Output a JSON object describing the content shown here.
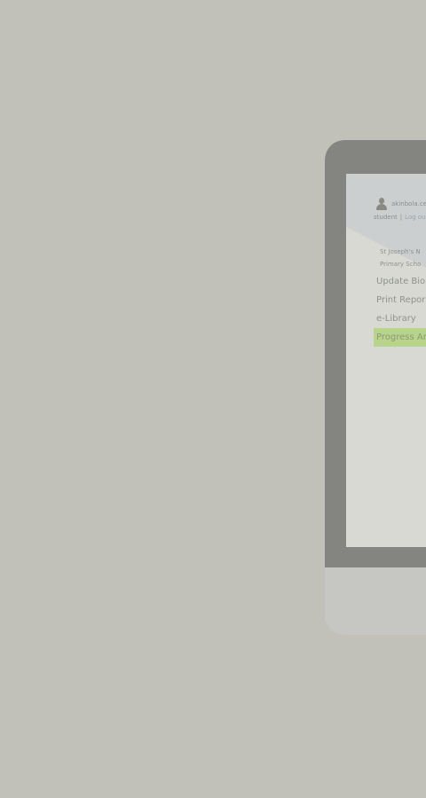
{
  "user": {
    "avatar_icon": "user-silhouette-icon",
    "username": "akinbola.ce",
    "role": "student",
    "separator": "|",
    "logout_label": "Log out"
  },
  "school": {
    "line1": "St Joseph's N",
    "line2": "Primary Scho"
  },
  "menu": {
    "items": [
      {
        "label": "Update Bio",
        "active": false
      },
      {
        "label": "Print Repor",
        "active": false
      },
      {
        "label": "e-Library",
        "active": false
      },
      {
        "label": "Progress An",
        "active": true
      }
    ]
  },
  "colors": {
    "background": "#c1c1b9",
    "device_frame": "#848580",
    "screen": "#d8d9d3",
    "active_menu": "#b8d38a",
    "link": "#93a7b7"
  }
}
